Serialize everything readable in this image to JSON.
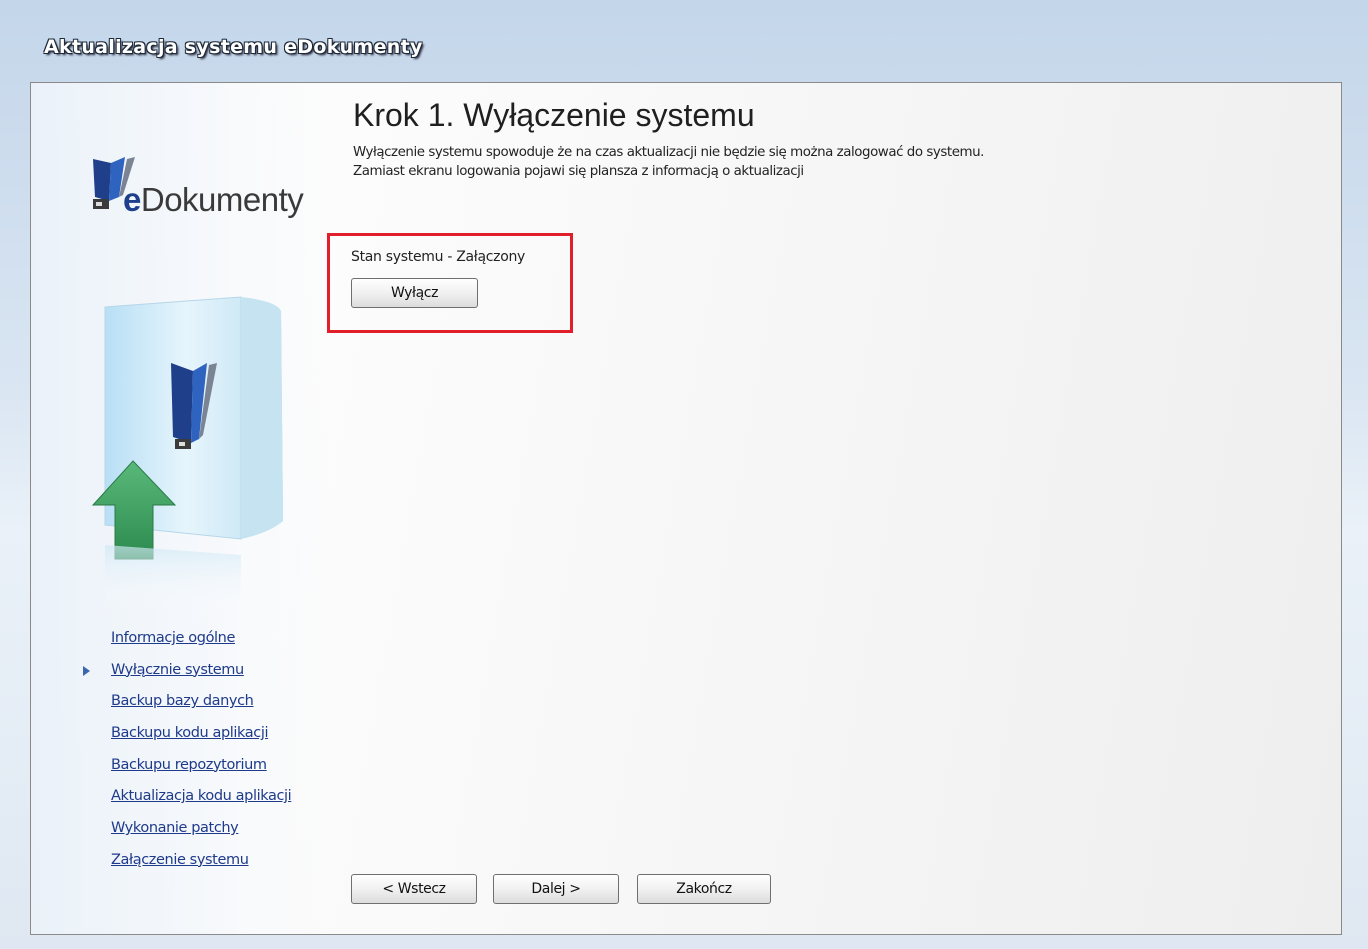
{
  "window": {
    "title": "Aktualizacja systemu eDokumenty"
  },
  "logo": {
    "brand_bold": "e",
    "brand_rest": "Dokumenty"
  },
  "step": {
    "title": "Krok 1. Wyłączenie systemu",
    "description_line1": "Wyłączenie systemu spowoduje że na czas aktualizacji nie będzie się można zalogować do systemu.",
    "description_line2": "Zamiast ekranu logowania pojawi się plansza z informacją o aktualizacji"
  },
  "status": {
    "text": "Stan systemu - Załączony",
    "button_label": "Wyłącz"
  },
  "nav": {
    "items": [
      {
        "label": "Informacje ogólne",
        "active": false
      },
      {
        "label": "Wyłącznie systemu",
        "active": true
      },
      {
        "label": "Backup bazy danych",
        "active": false
      },
      {
        "label": "Backupu kodu aplikacji",
        "active": false
      },
      {
        "label": "Backupu repozytorium",
        "active": false
      },
      {
        "label": "Aktualizacja kodu aplikacji",
        "active": false
      },
      {
        "label": "Wykonanie patchy",
        "active": false
      },
      {
        "label": "Załączenie systemu",
        "active": false
      }
    ]
  },
  "buttons": {
    "back": "< Wstecz",
    "next": "Dalej >",
    "finish": "Zakończ"
  },
  "colors": {
    "highlight_border": "#e01f2a",
    "link": "#1e3a8a",
    "brand_blue": "#1d3f8c"
  },
  "icons": {
    "logo": "edokumenty-logo-icon",
    "box": "software-box-icon",
    "arrow": "upload-arrow-icon",
    "active_marker": "triangle-right-icon"
  }
}
